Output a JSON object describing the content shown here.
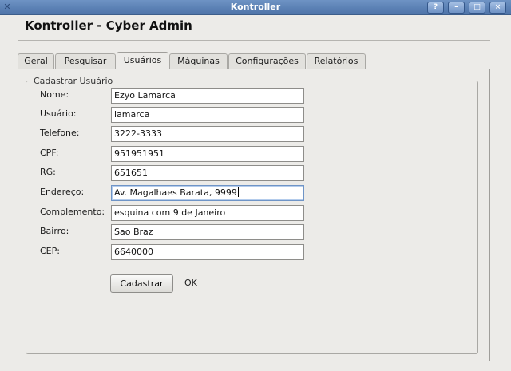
{
  "window": {
    "title": "Kontroller",
    "menu_icon": "app-menu-icon",
    "controls": {
      "help": "?",
      "minimize": "–",
      "maximize": "□",
      "close": "×"
    }
  },
  "header": {
    "app_title": "Kontroller - Cyber Admin"
  },
  "tabs": [
    {
      "label": "Geral"
    },
    {
      "label": "Pesquisar"
    },
    {
      "label": "Usuários",
      "active": true
    },
    {
      "label": "Máquinas"
    },
    {
      "label": "Configurações"
    },
    {
      "label": "Relatórios"
    }
  ],
  "form": {
    "legend": "Cadastrar Usuário",
    "fields": [
      {
        "label": "Nome:",
        "value": "Ezyo Lamarca"
      },
      {
        "label": "Usuário:",
        "value": "lamarca"
      },
      {
        "label": "Telefone:",
        "value": "3222-3333"
      },
      {
        "label": "CPF:",
        "value": "951951951"
      },
      {
        "label": "RG:",
        "value": "651651"
      },
      {
        "label": "Endereço:",
        "value": "Av. Magalhaes Barata, 9999",
        "focused": true
      },
      {
        "label": "Complemento:",
        "value": "esquina com 9 de Janeiro"
      },
      {
        "label": "Bairro:",
        "value": "Sao Braz"
      },
      {
        "label": "CEP:",
        "value": "6640000"
      }
    ],
    "submit_label": "Cadastrar",
    "status_text": "OK"
  },
  "colors": {
    "titlebar": "#5a7fb5",
    "window_bg": "#ecebe8",
    "focus_border": "#6f94c6"
  }
}
